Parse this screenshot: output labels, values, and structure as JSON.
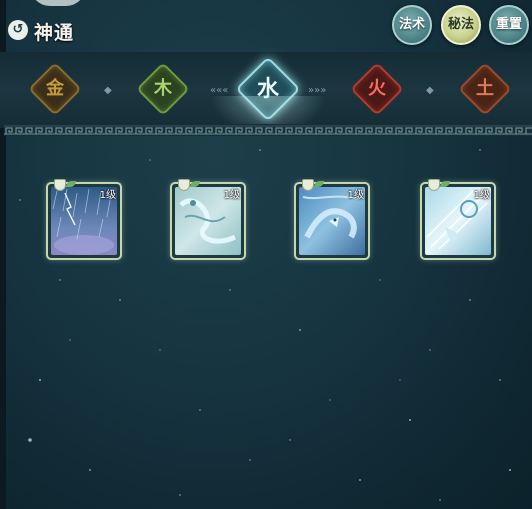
{
  "header": {
    "back_icon": "back-arrow-icon",
    "back_glyph": "↺",
    "title": "神通"
  },
  "top_buttons": [
    {
      "label": "法术",
      "active": false
    },
    {
      "label": "秘法",
      "active": true
    },
    {
      "label": "重置",
      "active": false
    }
  ],
  "elements": [
    {
      "label": "金",
      "color": "#c99a3c",
      "active": false
    },
    {
      "label": "木",
      "color": "#7fb04a",
      "active": false
    },
    {
      "label": "水",
      "color": "#9fe0e6",
      "active": true
    },
    {
      "label": "火",
      "color": "#e0453a",
      "active": false
    },
    {
      "label": "土",
      "color": "#d0663c",
      "active": false
    }
  ],
  "separators": [
    "◆",
    "«««",
    "»»»",
    "◆"
  ],
  "skills": [
    {
      "level": "1级",
      "art": "storm-rain-art"
    },
    {
      "level": "1级",
      "art": "water-serpent-art"
    },
    {
      "level": "1级",
      "art": "water-dragon-art"
    },
    {
      "level": "1级",
      "art": "ice-blade-art"
    }
  ]
}
